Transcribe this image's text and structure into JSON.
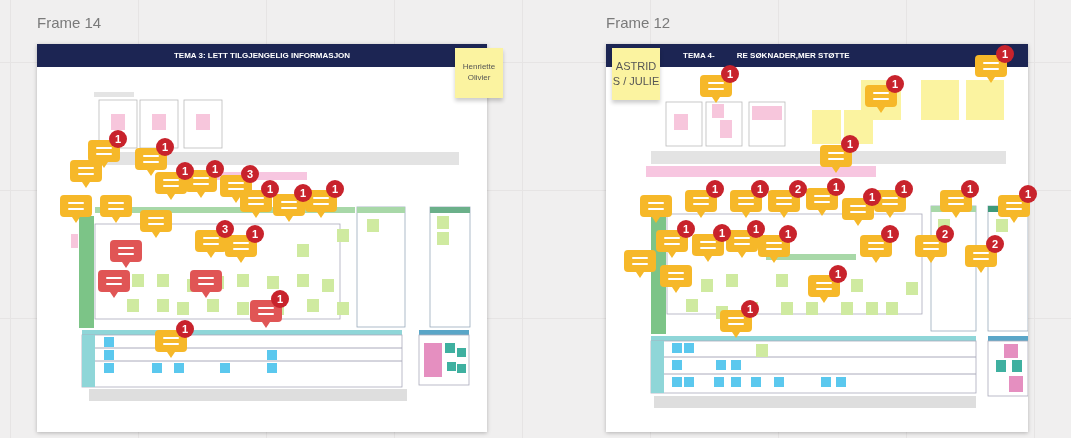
{
  "frames": [
    {
      "label": "Frame 14",
      "title": [
        "TEMA 3: LETT TILGJENGELIG INFORMASJON"
      ],
      "sticky": {
        "text": "Henriette Olivier"
      },
      "comments": [
        {
          "count": "1",
          "color": "#f6b829"
        },
        {
          "color": "#f6b829"
        },
        {
          "count": "1",
          "color": "#f6b829"
        },
        {
          "count": "1",
          "color": "#f6b829"
        },
        {
          "count": "1",
          "color": "#f6b829"
        },
        {
          "count": "3",
          "color": "#f6b829"
        },
        {
          "color": "#f6b829"
        },
        {
          "color": "#f6b829"
        },
        {
          "count": "1",
          "color": "#f6b829"
        },
        {
          "count": "1",
          "color": "#f6b829"
        },
        {
          "count": "1",
          "color": "#f6b829"
        },
        {
          "color": "#f6b829"
        },
        {
          "count": "3",
          "color": "#f6b829"
        },
        {
          "count": "1",
          "color": "#f6b829"
        },
        {
          "color": "#e05555"
        },
        {
          "color": "#e05555"
        },
        {
          "color": "#e05555"
        },
        {
          "count": "1",
          "color": "#e05555"
        },
        {
          "count": "1",
          "color": "#f6b829"
        }
      ]
    },
    {
      "label": "Frame 12",
      "title": [
        "TEMA 4-",
        "RE SØKNADER,MER STØTTE"
      ],
      "sticky": {
        "text": "ASTRID S / JULIE"
      },
      "comments": [
        {
          "count": "1",
          "color": "#f6b829"
        },
        {
          "count": "1",
          "color": "#f6b829"
        },
        {
          "count": "1",
          "color": "#f6b829"
        },
        {
          "count": "1",
          "color": "#f6b829"
        },
        {
          "color": "#f6b829"
        },
        {
          "count": "1",
          "color": "#f6b829"
        },
        {
          "count": "1",
          "color": "#f6b829"
        },
        {
          "count": "2",
          "color": "#f6b829"
        },
        {
          "count": "1",
          "color": "#f6b829"
        },
        {
          "count": "1",
          "color": "#f6b829"
        },
        {
          "count": "1",
          "color": "#f6b829"
        },
        {
          "count": "1",
          "color": "#f6b829"
        },
        {
          "count": "1",
          "color": "#f6b829"
        },
        {
          "count": "1",
          "color": "#f6b829"
        },
        {
          "count": "1",
          "color": "#f6b829"
        },
        {
          "count": "1",
          "color": "#f6b829"
        },
        {
          "count": "1",
          "color": "#f6b829"
        },
        {
          "color": "#f6b829"
        },
        {
          "color": "#f6b829"
        },
        {
          "count": "1",
          "color": "#f6b829"
        },
        {
          "count": "2",
          "color": "#f6b829"
        },
        {
          "count": "2",
          "color": "#f6b829"
        },
        {
          "count": "1",
          "color": "#f6b829"
        },
        {
          "count": "1",
          "color": "#f6b829"
        }
      ]
    }
  ]
}
